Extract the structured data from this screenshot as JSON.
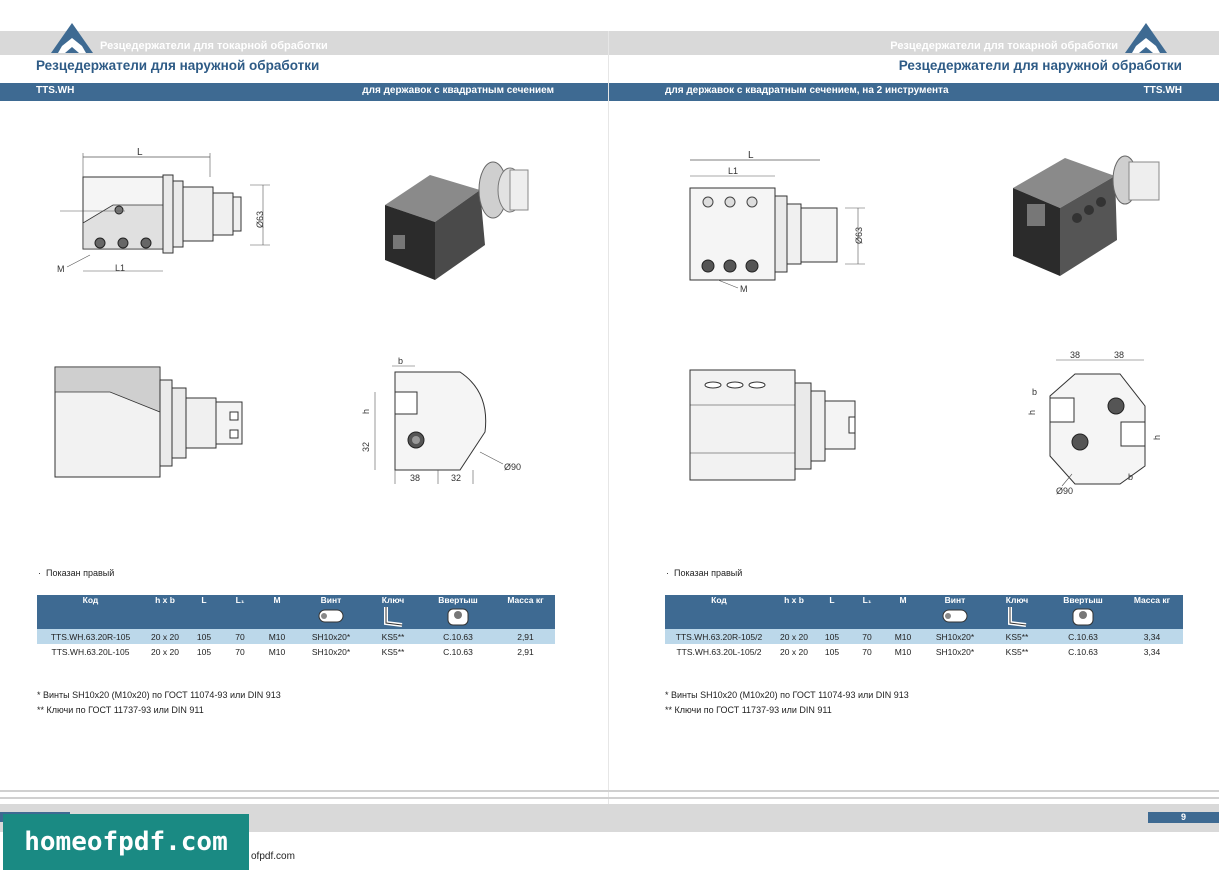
{
  "left": {
    "brand_line": "Резцедержатели для токарной обработки",
    "title": "Резцедержатели для наружной обработки",
    "code": "TTS.WH",
    "subtitle": "для державок с квадратным сечением",
    "note_shown": "Показан правый",
    "table": {
      "headers": [
        "Код",
        "h x b",
        "L",
        "L₁",
        "M",
        "Винт",
        "Ключ",
        "Ввертыш",
        "Масса кг"
      ],
      "rows": [
        [
          "TTS.WH.63.20R-105",
          "20 x 20",
          "105",
          "70",
          "M10",
          "SH10x20*",
          "KS5**",
          "C.10.63",
          "2,91"
        ],
        [
          "TTS.WH.63.20L-105",
          "20 x 20",
          "105",
          "70",
          "M10",
          "SH10x20*",
          "KS5**",
          "C.10.63",
          "2,91"
        ]
      ]
    },
    "footnote1": "* Винты SH10x20 (M10x20)  по ГОСТ 11074-93 или DIN 913",
    "footnote2": "** Ключи по ГОСТ 11737-93 или DIN 911",
    "dims_side": {
      "L": "L",
      "L1": "L1",
      "d": "Ø63",
      "M": "M"
    },
    "dims_front": {
      "b": "b",
      "h": "h",
      "v32": "32",
      "h38": "38",
      "h32": "32",
      "d90": "Ø90"
    }
  },
  "right": {
    "brand_line": "Резцедержатели для токарной обработки",
    "title": "Резцедержатели для наружной обработки",
    "code": "TTS.WH",
    "subtitle": "для державок с квадратным сечением, на 2 инструмента",
    "note_shown": "Показан правый",
    "table": {
      "headers": [
        "Код",
        "h x b",
        "L",
        "L₁",
        "M",
        "Винт",
        "Ключ",
        "Ввертыш",
        "Масса кг"
      ],
      "rows": [
        [
          "TTS.WH.63.20R-105/2",
          "20 x 20",
          "105",
          "70",
          "M10",
          "SH10x20*",
          "KS5**",
          "C.10.63",
          "3,34"
        ],
        [
          "TTS.WH.63.20L-105/2",
          "20 x 20",
          "105",
          "70",
          "M10",
          "SH10x20*",
          "KS5**",
          "C.10.63",
          "3,34"
        ]
      ]
    },
    "footnote1": "* Винты SH10x20 (M10x20)  по ГОСТ 11074-93 или DIN 913",
    "footnote2": "** Ключи по ГОСТ 11737-93 или DIN 911",
    "dims_side": {
      "L": "L",
      "L1": "L1",
      "d": "Ø63",
      "M": "M"
    },
    "dims_front": {
      "a": "38",
      "b2": "38",
      "b": "b",
      "h": "h",
      "h2": "h",
      "bb": "b",
      "d90": "Ø90"
    },
    "page_number": "9"
  },
  "watermark": {
    "text": "homeofpdf.com",
    "url_fragment": "ofpdf.com"
  },
  "colors": {
    "accent": "#3e6a92",
    "title": "#2e5b86",
    "highlight_row": "#bcd8ea",
    "watermark": "#1a8a83"
  }
}
